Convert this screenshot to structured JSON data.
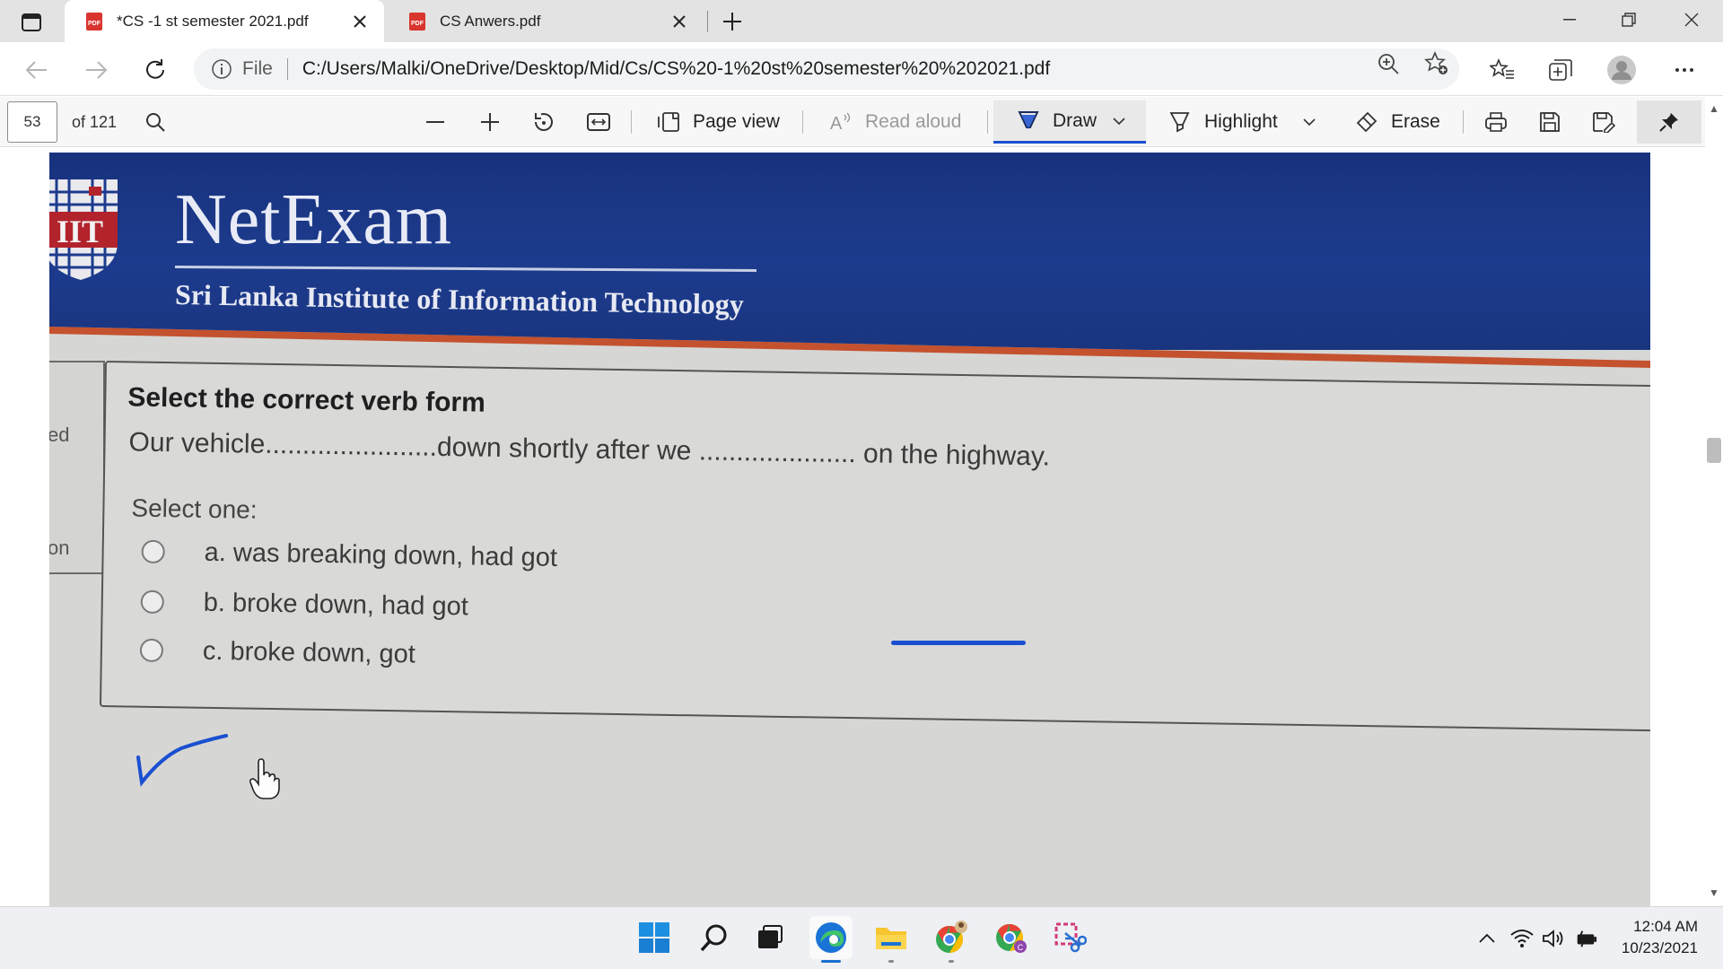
{
  "browser": {
    "tabs": [
      {
        "title": "*CS -1 st semester 2021.pdf",
        "active": true,
        "icon": "pdf-icon"
      },
      {
        "title": "CS Anwers.pdf",
        "active": false,
        "icon": "pdf-icon"
      }
    ],
    "address": {
      "scheme_label": "File",
      "url": "C:/Users/Malki/OneDrive/Desktop/Mid/Cs/CS%20-1%20st%20semester%20%202021.pdf"
    }
  },
  "pdf_toolbar": {
    "page_number": "53",
    "page_count": "of 121",
    "page_view_label": "Page view",
    "read_aloud_label": "Read aloud",
    "draw_label": "Draw",
    "highlight_label": "Highlight",
    "erase_label": "Erase",
    "accent_color": "#1a4fd0"
  },
  "document": {
    "banner": {
      "logo_text": "IIT",
      "title": "NetExam",
      "subtitle": "Sri Lanka Institute of Information Technology"
    },
    "left_panel": {
      "text1": "ed",
      "text2": "on"
    },
    "question": {
      "title": "Select the correct verb form",
      "text": "Our vehicle.......................down shortly after we ..................... on the highway.",
      "select_label": "Select one:",
      "options": [
        {
          "label": "a. was breaking down, had got",
          "checked": false
        },
        {
          "label": "b. broke down, had got",
          "checked": false,
          "ink_checkmark": true
        },
        {
          "label": "c. broke down, got",
          "checked": false
        }
      ]
    },
    "ink_color": "#1a4fd0"
  },
  "taskbar": {
    "apps": [
      "windows-start",
      "search",
      "task-view",
      "edge",
      "file-explorer",
      "chrome-profile-1",
      "chrome-profile-2",
      "snipping-tool"
    ],
    "time": "12:04 AM",
    "date": "10/23/2021"
  }
}
